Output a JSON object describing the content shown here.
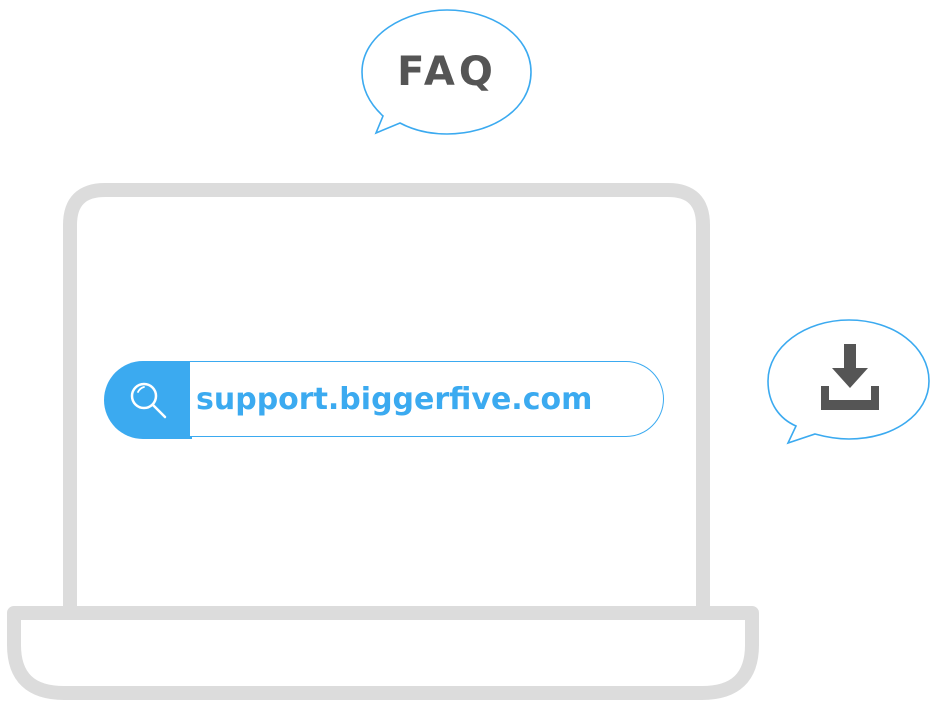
{
  "faq_bubble": {
    "label": "FAQ"
  },
  "search": {
    "url": "support.biggerfive.com"
  },
  "icons": {
    "search": "search-icon",
    "download": "download-icon"
  },
  "colors": {
    "accent": "#3baaf0",
    "laptop": "#dcdcdc",
    "text": "#555555"
  }
}
